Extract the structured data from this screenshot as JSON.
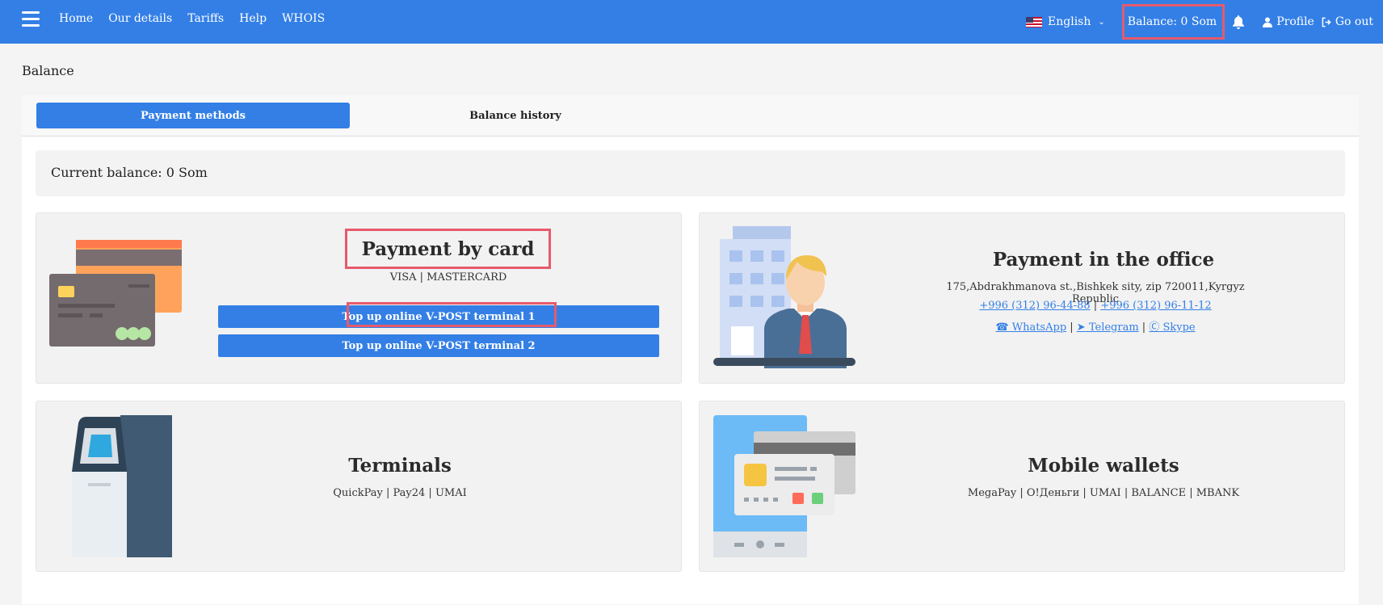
{
  "header": {
    "nav": [
      "Home",
      "Our details",
      "Tariffs",
      "Help",
      "WHOIS"
    ],
    "language": "English",
    "balance": "Balance: 0 Som",
    "profile": "Profile",
    "logout": "Go out",
    "color": "#337fe6"
  },
  "page": {
    "title": "Balance",
    "tabs": [
      "Payment methods",
      "Balance history"
    ],
    "current_balance": "Current balance: 0 Som"
  },
  "methods": {
    "card": {
      "title": "Payment by card",
      "subtitle": "VISA | MASTERCARD",
      "buttons": [
        "Top up online V-POST terminal 1",
        "Top up online V-POST terminal 2"
      ]
    },
    "office": {
      "title": "Payment in the office",
      "address": "175,Abdrakhmanova st.,Bishkek sity, zip 720011,Kyrgyz Republic",
      "phone1": "+996 (312) 96-44-88",
      "phone2": "+996 (312) 96-11-12",
      "whatsapp": " WhatsApp",
      "telegram": " Telegram",
      "skype": " Skype"
    },
    "terminals": {
      "title": "Terminals",
      "subtitle": "QuickPay | Pay24 | UMAI"
    },
    "wallets": {
      "title": "Mobile wallets",
      "subtitle": "MegaPay | О!Деньги | UMAI | BALANCE | MBANK"
    }
  }
}
